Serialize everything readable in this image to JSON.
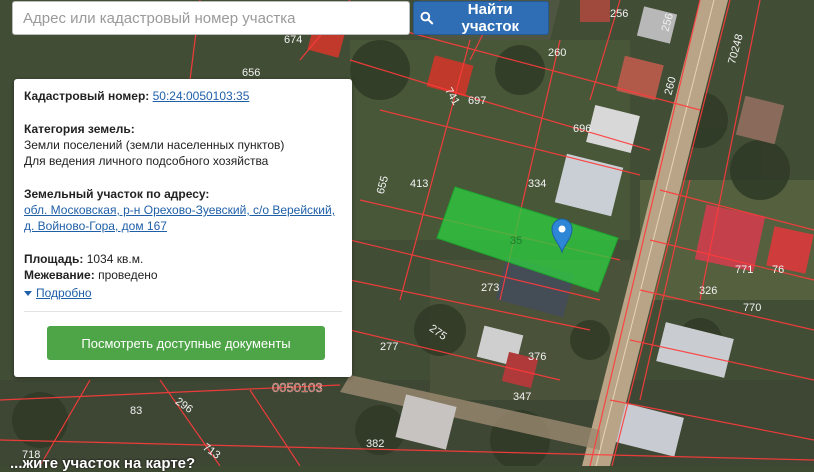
{
  "search": {
    "placeholder": "Адрес или кадастровый номер участка",
    "button_label": "Найти участок"
  },
  "info_panel": {
    "cadastral_label": "Кадастровый номер:",
    "cadastral_number": "50:24:0050103:35",
    "category_label": "Категория земель:",
    "category_value": "Земли поселений (земли населенных пунктов)",
    "use_value": "Для ведения личного подсобного хозяйства",
    "address_label": "Земельный участок по адресу:",
    "address_line1": "обл. Московская, р-н Орехово-Зуевский, с/о Верейский,",
    "address_line2": "д. Войново-Гора, дом 167",
    "area_label": "Площадь:",
    "area_value": "1034 кв.м.",
    "survey_label": "Межевание:",
    "survey_value": "проведено",
    "more_link": "Подробно",
    "docs_button": "Посмотреть доступные документы"
  },
  "map": {
    "parcel_labels": [
      "674",
      "256",
      "256",
      "260",
      "656",
      "260",
      "697",
      "741",
      "696",
      "413",
      "334",
      "655",
      "35",
      "273",
      "771",
      "76",
      "326",
      "770",
      "275",
      "376",
      "277",
      "347",
      "83",
      "296",
      "382",
      "713",
      "718",
      "70248",
      "0050103"
    ],
    "selected_parcel": "35",
    "colors": {
      "selected_fill": "#2ecc40",
      "boundary": "#ff3b3b",
      "marker": "#2d86d6"
    }
  },
  "bottom_hint": "...жите участок на карте?"
}
